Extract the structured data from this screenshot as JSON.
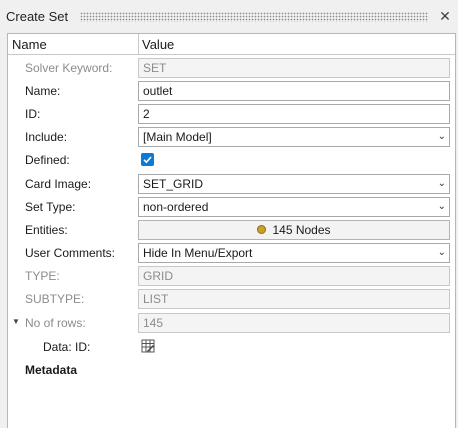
{
  "window": {
    "title": "Create Set"
  },
  "header": {
    "name_col": "Name",
    "value_col": "Value"
  },
  "rows": {
    "solver_keyword": {
      "label": "Solver Keyword:",
      "value": "SET"
    },
    "name": {
      "label": "Name:",
      "value": "outlet"
    },
    "id": {
      "label": "ID:",
      "value": "2"
    },
    "include": {
      "label": "Include:",
      "value": "[Main Model]"
    },
    "defined": {
      "label": "Defined:",
      "checked": true
    },
    "card_image": {
      "label": "Card Image:",
      "value": "SET_GRID"
    },
    "set_type": {
      "label": "Set Type:",
      "value": "non-ordered"
    },
    "entities": {
      "label": "Entities:",
      "value": "145 Nodes"
    },
    "user_comments": {
      "label": "User Comments:",
      "value": "Hide In Menu/Export"
    },
    "type": {
      "label": "TYPE:",
      "value": "GRID"
    },
    "subtype": {
      "label": "SUBTYPE:",
      "value": "LIST"
    },
    "no_of_rows": {
      "label": "No of rows:",
      "value": "145"
    },
    "data_id": {
      "label": "Data: ID:"
    },
    "metadata": {
      "label": "Metadata"
    }
  },
  "colors": {
    "accent": "#0a7ad6",
    "entity_dot": "#c9a227"
  },
  "icons": {
    "close": "close-icon",
    "dropdown": "chevron-down-icon",
    "table": "table-edit-icon"
  }
}
